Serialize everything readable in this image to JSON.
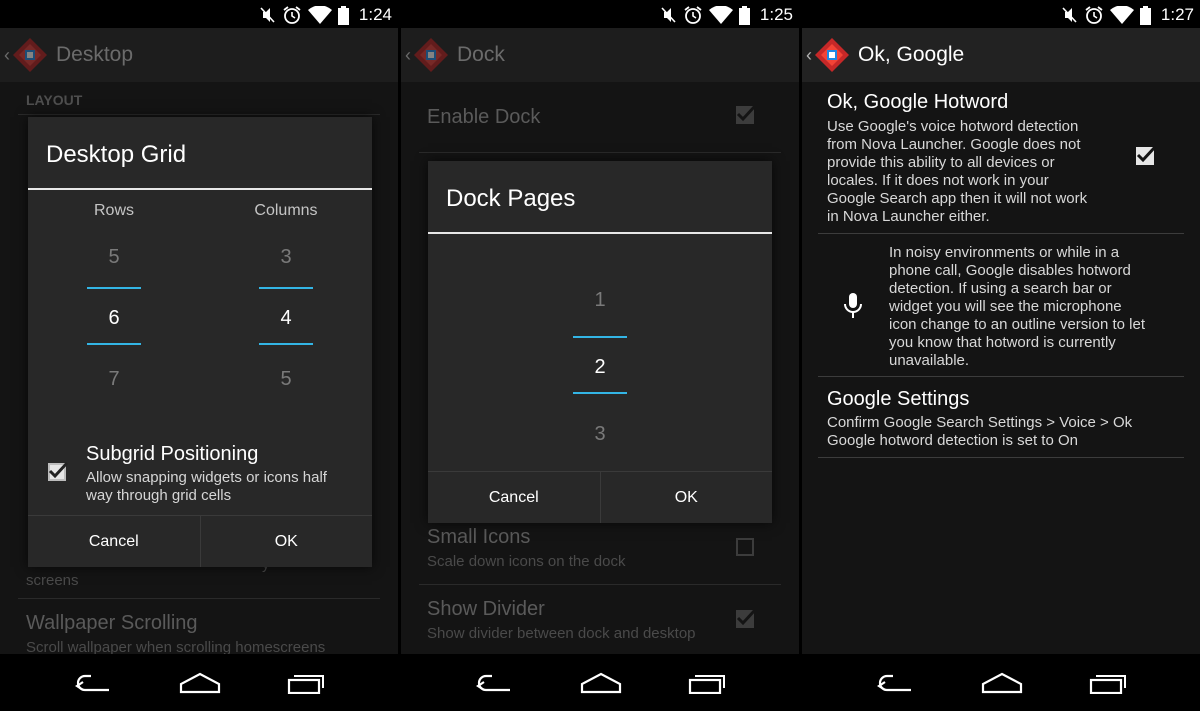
{
  "status": [
    {
      "time": "1:24"
    },
    {
      "time": "1:25"
    },
    {
      "time": "1:27"
    }
  ],
  "panel1": {
    "title": "Desktop",
    "section_header": "LAYOUT",
    "bg_summary_fragment": "screens",
    "bg_summary_fragment2": "y",
    "wallpaper_scrolling_title": "Wallpaper Scrolling",
    "wallpaper_scrolling_summary": "Scroll wallpaper when scrolling homescreens",
    "dialog": {
      "title": "Desktop Grid",
      "rows_label": "Rows",
      "columns_label": "Columns",
      "rows": {
        "prev": "5",
        "selected": "6",
        "next": "7"
      },
      "columns": {
        "prev": "3",
        "selected": "4",
        "next": "5"
      },
      "subgrid_title": "Subgrid Positioning",
      "subgrid_summary_line1": "Allow snapping widgets or icons half",
      "subgrid_summary_line2": "way through grid cells",
      "subgrid_checked": true,
      "cancel_label": "Cancel",
      "ok_label": "OK"
    }
  },
  "panel2": {
    "title": "Dock",
    "enable_dock_title": "Enable Dock",
    "small_icons_title": "Small Icons",
    "small_icons_summary": "Scale down icons on the dock",
    "show_divider_title": "Show Divider",
    "show_divider_summary": "Show divider between dock and desktop",
    "dialog": {
      "title": "Dock Pages",
      "prev": "1",
      "selected": "2",
      "next": "3",
      "cancel_label": "Cancel",
      "ok_label": "OK"
    }
  },
  "panel3": {
    "title": "Ok, Google",
    "hotword_title": "Ok, Google Hotword",
    "hotword_summary": [
      "Use Google's voice hotword detection",
      "from Nova Launcher. Google does not",
      "provide this ability to all devices or",
      "locales. If it does not work in your",
      "Google Search app then it will not work",
      "in Nova Launcher either."
    ],
    "hotword_checked": true,
    "info_text": [
      "In noisy environments or while in a",
      "phone call, Google disables hotword",
      "detection. If using a search bar or",
      "widget you will see the microphone",
      "icon change to an outline version to let",
      "you know that hotword is currently",
      "unavailable."
    ],
    "settings_title": "Google Settings",
    "settings_summary": [
      "Confirm Google Search Settings > Voice > Ok",
      "Google hotword detection is set to On"
    ]
  },
  "colors": {
    "accent": "#33b5e5",
    "panel_bg": "#141414",
    "dialog_bg": "#282828"
  },
  "icons": [
    "muted-icon",
    "alarm-icon",
    "wifi-icon",
    "battery-icon",
    "back-icon",
    "home-icon",
    "recents-icon",
    "microphone-icon",
    "nova-logo-icon",
    "checkmark-icon"
  ]
}
